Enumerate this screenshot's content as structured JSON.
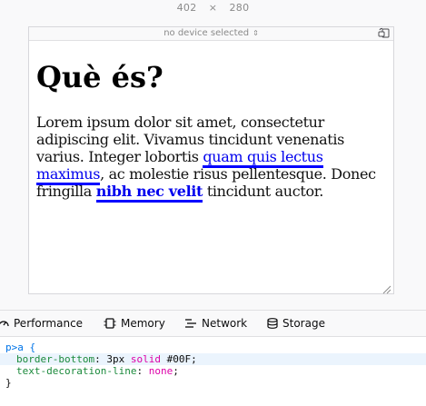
{
  "viewport_size": {
    "width": "402",
    "separator": "×",
    "height": "280"
  },
  "device_bar": {
    "device_label": "no device selected",
    "chevron": "⇕",
    "rotate_icon": "rotate-device-icon"
  },
  "page": {
    "heading": "Què és?",
    "paragraph": {
      "text1": "Lorem ipsum dolor sit amet, consectetur adipiscing elit. Vivamus tincidunt venenatis varius. Integer lobortis ",
      "link1": "quam quis lectus maximus",
      "text2": ", ac molestie risus pellentesque. Donec fringilla ",
      "link2": "nibh nec velit",
      "text3": " tincidunt auctor."
    },
    "link_color": "#0000ee",
    "link_border_color": "#00F"
  },
  "devtools_tabs": [
    {
      "label": "Performance",
      "icon": "performance-icon"
    },
    {
      "label": "Memory",
      "icon": "memory-icon"
    },
    {
      "label": "Network",
      "icon": "network-icon"
    },
    {
      "label": "Storage",
      "icon": "storage-icon"
    }
  ],
  "css_rule": {
    "selector": "p>a {",
    "decl1": {
      "name": "border-bottom",
      "value_num": "3px",
      "value_kw": "solid",
      "value_color": "#00F"
    },
    "decl2": {
      "name": "text-decoration-line",
      "value": "none"
    },
    "close": "}"
  },
  "colors": {
    "accent_blue": "#0074e8",
    "prop_green": "#1b8a3c",
    "value_magenta": "#dd00a9",
    "highlight_row": "#ebf4fd"
  }
}
